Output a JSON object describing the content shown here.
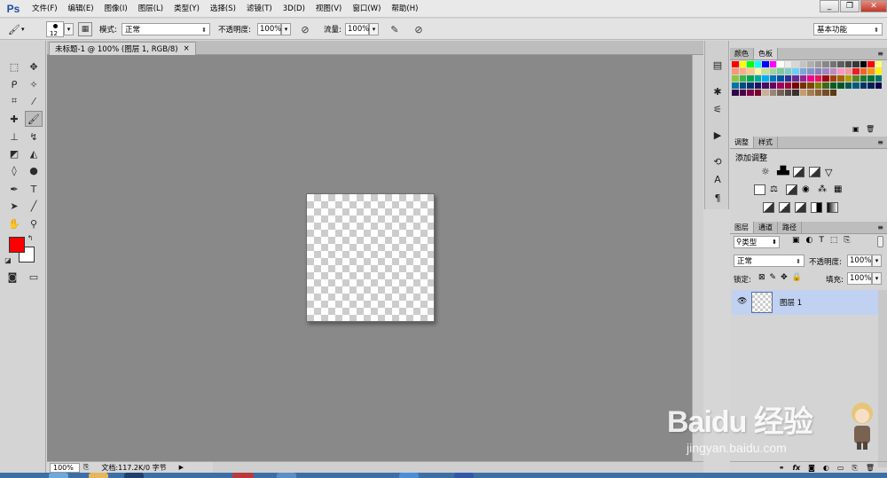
{
  "app": {
    "logo": "Ps"
  },
  "menu": {
    "items": [
      "文件(F)",
      "编辑(E)",
      "图像(I)",
      "图层(L)",
      "类型(Y)",
      "选择(S)",
      "滤镜(T)",
      "3D(D)",
      "视图(V)",
      "窗口(W)",
      "帮助(H)"
    ]
  },
  "window_controls": {
    "minimize": "_",
    "restore": "❐",
    "close": "✕"
  },
  "options": {
    "brush_size": "12",
    "mode_label": "模式:",
    "mode_value": "正常",
    "opacity_label": "不透明度:",
    "opacity_value": "100%",
    "flow_label": "流量:",
    "flow_value": "100%",
    "workspace": "基本功能"
  },
  "document": {
    "tab_title": "未标题-1 @ 100% (图层 1, RGB/8)"
  },
  "status": {
    "zoom": "100%",
    "doc_info": "文档:117.2K/0 字节"
  },
  "colors": {
    "foreground": "#ff0000",
    "background": "#ffffff",
    "selected_layer_bg": "#c0d1f1"
  },
  "tools": [
    "marquee-icon",
    "move-icon",
    "lasso-icon",
    "magic-wand-icon",
    "crop-icon",
    "eyedropper-icon",
    "healing-brush-icon",
    "brush-icon",
    "clone-stamp-icon",
    "history-brush-icon",
    "eraser-icon",
    "paint-bucket-icon",
    "blur-icon",
    "dodge-icon",
    "pen-icon",
    "type-icon",
    "path-select-icon",
    "line-icon",
    "hand-icon",
    "zoom-icon"
  ],
  "swatches_panel": {
    "tabs": [
      "颜色",
      "色板"
    ],
    "active_tab": "色板",
    "colors": [
      "#ff0000",
      "#ffff00",
      "#00ff00",
      "#00ffff",
      "#0000ff",
      "#ff00ff",
      "#ffffff",
      "#ebebeb",
      "#d7d7d7",
      "#c3c3c3",
      "#afafaf",
      "#9b9b9b",
      "#878787",
      "#737373",
      "#5f5f5f",
      "#4b4b4b",
      "#373737",
      "#000000",
      "#ff0000",
      "#ffff66",
      "#f7977a",
      "#f9ad81",
      "#fdc68a",
      "#fff79a",
      "#c4df9b",
      "#a3d39c",
      "#82ca9d",
      "#7bcdc8",
      "#6ecff6",
      "#7ea7d8",
      "#8493ca",
      "#8882be",
      "#a187be",
      "#bc8dbf",
      "#f49ac2",
      "#f6989d",
      "#ed1c24",
      "#f26522",
      "#f7941d",
      "#fff200",
      "#8dc73f",
      "#39b54a",
      "#00a651",
      "#00a99d",
      "#00aeef",
      "#0072bc",
      "#0054a6",
      "#2e3192",
      "#662d91",
      "#92278f",
      "#ec008c",
      "#ed145b",
      "#9e0b0f",
      "#a0410d",
      "#a3620a",
      "#aba000",
      "#598527",
      "#197b30",
      "#007236",
      "#00746b",
      "#0076a3",
      "#004b80",
      "#003471",
      "#1b1464",
      "#440e62",
      "#630460",
      "#9e005d",
      "#9e0039",
      "#790000",
      "#7b2e00",
      "#7d4900",
      "#827b00",
      "#406618",
      "#005e20",
      "#005826",
      "#005952",
      "#005b7f",
      "#003663",
      "#002157",
      "#0d004c",
      "#32004b",
      "#4b0049",
      "#7b0046",
      "#7a0026",
      "#c7b299",
      "#998675",
      "#736357",
      "#534741",
      "#37302d",
      "#c69c6d",
      "#a67c52",
      "#8c6239",
      "#754c24",
      "#603913"
    ]
  },
  "adjustments_panel": {
    "tabs": [
      "调整",
      "样式"
    ],
    "active_tab": "调整",
    "title": "添加调整",
    "icons": [
      "brightness-icon",
      "levels-icon",
      "curves-icon",
      "exposure-icon",
      "vibrance-icon",
      "hue-saturation-icon",
      "color-balance-icon",
      "black-white-icon",
      "photo-filter-icon",
      "channel-mixer-icon",
      "color-lookup-icon",
      "invert-icon",
      "posterize-icon",
      "threshold-icon",
      "selective-color-icon",
      "gradient-map-icon"
    ]
  },
  "layers_panel": {
    "tabs": [
      "图层",
      "通道",
      "路径"
    ],
    "active_tab": "图层",
    "filter_label": "类型",
    "blend_mode": "正常",
    "opacity_label": "不透明度:",
    "opacity_value": "100%",
    "lock_label": "锁定:",
    "fill_label": "填充:",
    "fill_value": "100%",
    "layers": [
      {
        "name": "图层 1",
        "visible": true,
        "selected": true
      }
    ],
    "bottom_icons": [
      "link-icon",
      "fx-icon",
      "mask-icon",
      "adjustment-layer-icon",
      "group-icon",
      "new-layer-icon",
      "trash-icon"
    ]
  },
  "watermark": {
    "brand": "Baidu 经验",
    "url": "jingyan.baidu.com"
  }
}
